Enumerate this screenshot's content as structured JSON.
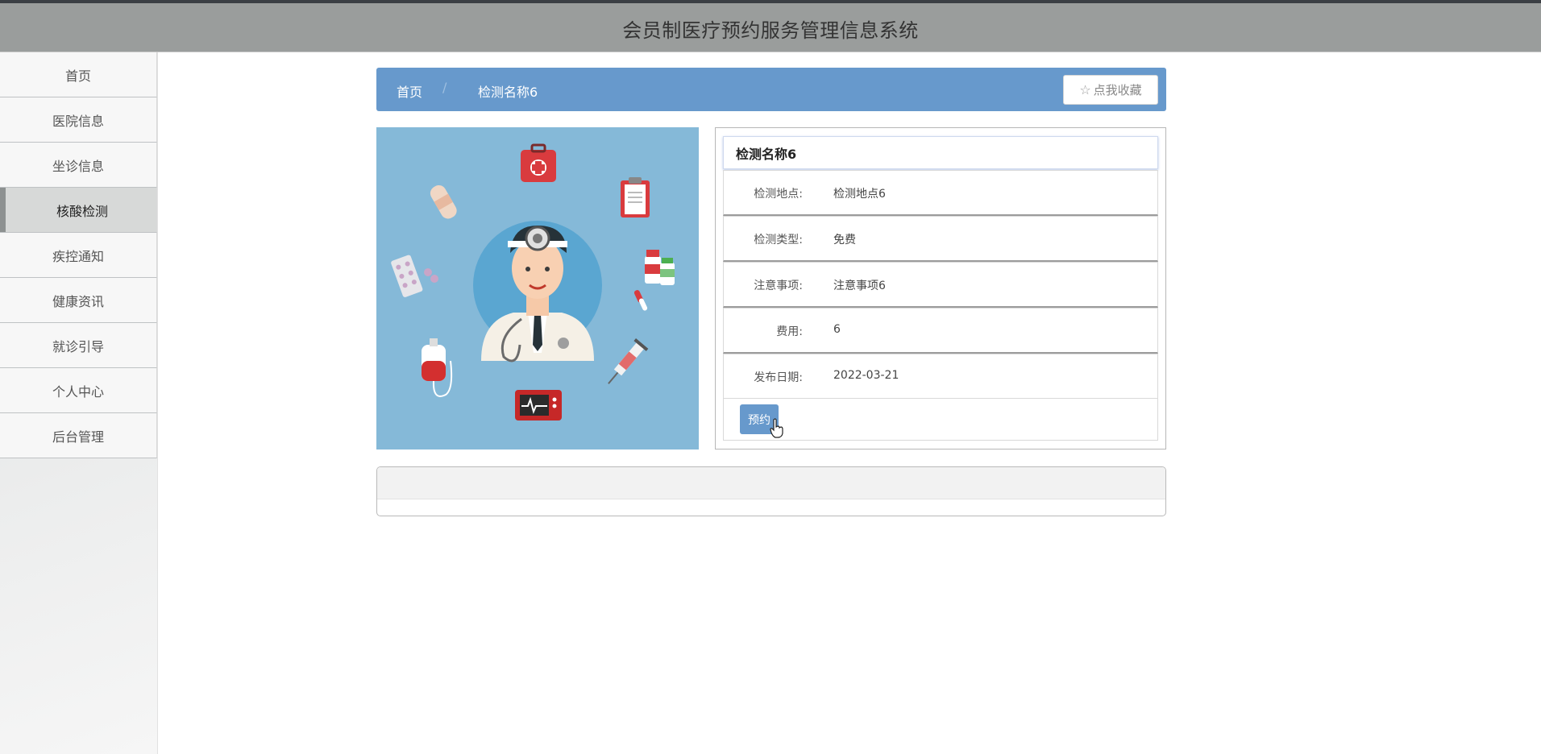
{
  "header": {
    "title": "会员制医疗预约服务管理信息系统"
  },
  "sidebar": {
    "items": [
      {
        "label": "首页",
        "active": false
      },
      {
        "label": "医院信息",
        "active": false
      },
      {
        "label": "坐诊信息",
        "active": false
      },
      {
        "label": "核酸检测",
        "active": true
      },
      {
        "label": "疾控通知",
        "active": false
      },
      {
        "label": "健康资讯",
        "active": false
      },
      {
        "label": "就诊引导",
        "active": false
      },
      {
        "label": "个人中心",
        "active": false
      },
      {
        "label": "后台管理",
        "active": false
      }
    ]
  },
  "breadcrumb": {
    "home": "首页",
    "separator": "/",
    "current": "检测名称6"
  },
  "favorite": {
    "icon": "star-outline-icon",
    "label": "点我收藏"
  },
  "detail": {
    "title": "检测名称6",
    "fields": [
      {
        "key": "检测地点:",
        "value": "检测地点6"
      },
      {
        "key": "检测类型:",
        "value": "免费"
      },
      {
        "key": "注意事项:",
        "value": "注意事项6"
      },
      {
        "key": "费用:",
        "value": "6"
      },
      {
        "key": "发布日期:",
        "value": "2022-03-21"
      }
    ],
    "book_label": "预约"
  },
  "colors": {
    "accent": "#6799cc",
    "header_bg": "#9a9d9c",
    "image_bg": "#85b9d8"
  }
}
